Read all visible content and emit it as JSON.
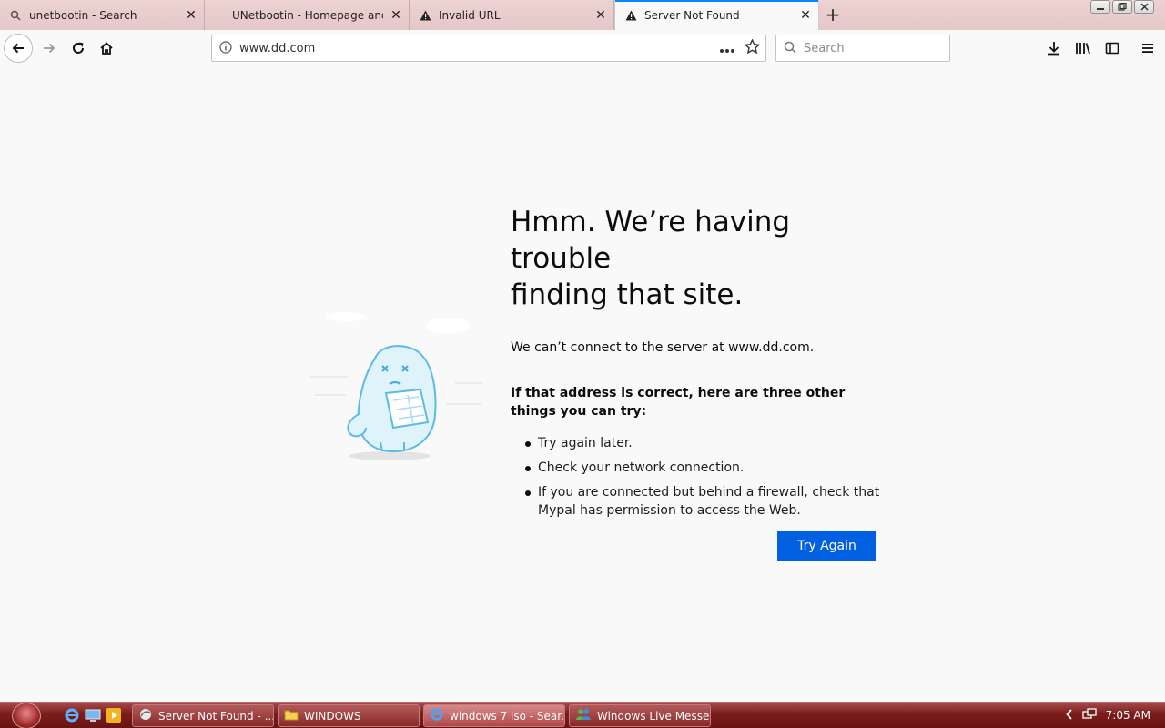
{
  "tabs": [
    {
      "label": "unetbootin - Search",
      "icon": "search-icon",
      "active": false
    },
    {
      "label": "UNetbootin - Homepage and D",
      "icon": "none",
      "active": false
    },
    {
      "label": "Invalid URL",
      "icon": "warning-icon",
      "active": false
    },
    {
      "label": "Server Not Found",
      "icon": "warning-icon",
      "active": true
    }
  ],
  "navbar": {
    "url": "www.dd.com",
    "search_placeholder": "Search"
  },
  "error": {
    "title_line1": "Hmm. We’re having trouble",
    "title_line2": "finding that site.",
    "description": "We can’t connect to the server at www.dd.com.",
    "subheading": "If that address is correct, here are three other things you can try:",
    "suggestions": [
      "Try again later.",
      "Check your network connection.",
      "If you are connected but behind a firewall, check that Mypal has permission to access the Web."
    ],
    "button": "Try Again"
  },
  "taskbar": {
    "items": [
      {
        "label": "Server Not Found - ...",
        "icon": "browser-icon"
      },
      {
        "label": "WINDOWS",
        "icon": "folder-icon"
      },
      {
        "label": "windows 7 iso - Sear...",
        "icon": "ie-icon"
      },
      {
        "label": "Windows Live Messe...",
        "icon": "messenger-icon"
      }
    ],
    "clock": "7:05 AM"
  },
  "colors": {
    "accent": "#0a84ff",
    "button": "#0060df",
    "taskbar": "#7a1c1c"
  }
}
